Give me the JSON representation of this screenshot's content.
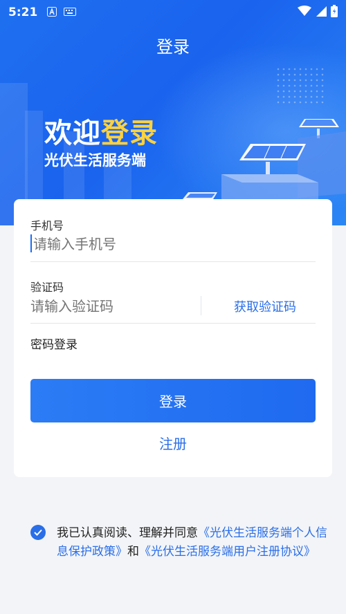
{
  "status_bar": {
    "time": "5:21",
    "icons": [
      "a-box-icon",
      "keyboard-icon",
      "wifi-icon",
      "signal-icon",
      "battery-icon"
    ]
  },
  "header": {
    "title": "登录"
  },
  "hero": {
    "welcome_prefix": "欢迎",
    "welcome_highlight": "登录",
    "app_name": "光伏生活服务端"
  },
  "form": {
    "phone": {
      "label": "手机号",
      "placeholder": "请输入手机号"
    },
    "code": {
      "label": "验证码",
      "placeholder": "请输入验证码",
      "get_code_label": "获取验证码"
    },
    "password_login_label": "密码登录",
    "login_button": "登录",
    "register_link": "注册"
  },
  "agreement": {
    "checked": true,
    "prefix": "我已认真阅读、理解并同意",
    "privacy_link": "《光伏生活服务端个人信息保护政策》",
    "conjunction": "和",
    "user_agreement_link": "《光伏生活服务端用户注册协议》"
  },
  "colors": {
    "primary": "#1f6af0",
    "highlight": "#ffd23c",
    "link": "#2a6ee8",
    "background": "#f2f4f7"
  }
}
